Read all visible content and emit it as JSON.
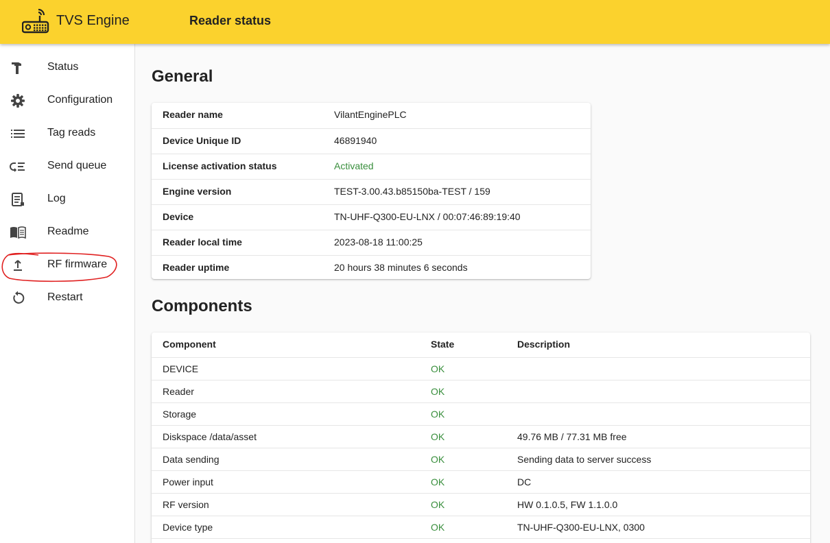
{
  "header": {
    "app_title": "TVS Engine",
    "page_title": "Reader status",
    "brand_color": "#fbd22d",
    "logo_icon": "radio-router-icon"
  },
  "sidebar": {
    "items": [
      {
        "label": "Status",
        "icon": "hammer-icon"
      },
      {
        "label": "Configuration",
        "icon": "gear-icon"
      },
      {
        "label": "Tag reads",
        "icon": "list-icon"
      },
      {
        "label": "Send queue",
        "icon": "queue-icon"
      },
      {
        "label": "Log",
        "icon": "log-icon"
      },
      {
        "label": "Readme",
        "icon": "book-icon"
      },
      {
        "label": "RF firmware",
        "icon": "upload-icon"
      },
      {
        "label": "Restart",
        "icon": "restart-icon"
      }
    ],
    "annotation_color": "#e02020"
  },
  "general": {
    "title": "General",
    "rows": [
      {
        "key": "Reader name",
        "value": "VilantEnginePLC"
      },
      {
        "key": "Device Unique ID",
        "value": "46891940"
      },
      {
        "key": "License activation status",
        "value": "Activated"
      },
      {
        "key": "Engine version",
        "value": "TEST-3.00.43.b85150ba-TEST / 159"
      },
      {
        "key": "Device",
        "value": "TN-UHF-Q300-EU-LNX / 00:07:46:89:19:40"
      },
      {
        "key": "Reader local time",
        "value": "2023-08-18 11:00:25"
      },
      {
        "key": "Reader uptime",
        "value": "20 hours 38 minutes 6 seconds"
      }
    ]
  },
  "components": {
    "title": "Components",
    "columns": [
      "Component",
      "State",
      "Description"
    ],
    "rows": [
      {
        "component": "DEVICE",
        "state": "OK",
        "description": ""
      },
      {
        "component": "Reader",
        "state": "OK",
        "description": ""
      },
      {
        "component": "Storage",
        "state": "OK",
        "description": ""
      },
      {
        "component": "Diskspace /data/asset",
        "state": "OK",
        "description": "49.76 MB / 77.31 MB free"
      },
      {
        "component": "Data sending",
        "state": "OK",
        "description": "Sending data to server success"
      },
      {
        "component": "Power input",
        "state": "OK",
        "description": "DC"
      },
      {
        "component": "RF version",
        "state": "OK",
        "description": "HW 0.1.0.5, FW 1.1.0.0"
      },
      {
        "component": "Device type",
        "state": "OK",
        "description": "TN-UHF-Q300-EU-LNX, 0300"
      }
    ]
  }
}
